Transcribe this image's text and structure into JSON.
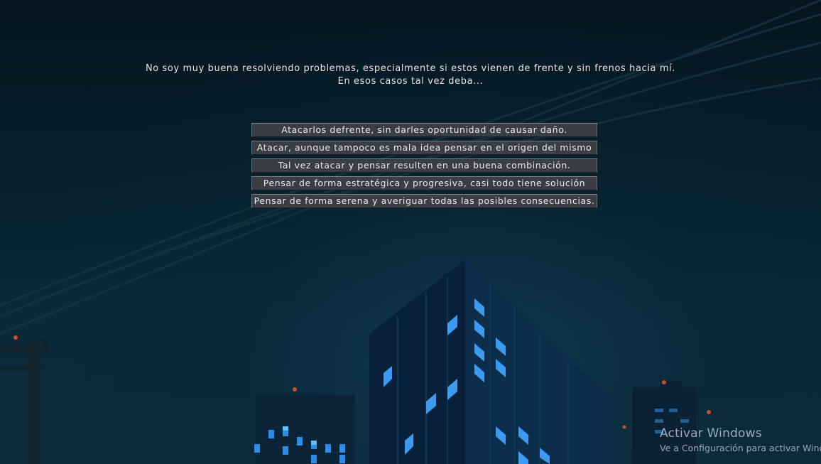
{
  "dialogue": {
    "line1": "No soy muy buena resolviendo problemas, especialmente si estos vienen de frente y sin frenos hacia mí.",
    "line2": "En esos casos tal vez deba..."
  },
  "choices": [
    "Atacarlos defrente, sin darles oportunidad de causar daño.",
    "Atacar, aunque tampoco es mala idea pensar en el origen del mismo",
    "Tal vez atacar y pensar resulten en una buena combinación.",
    "Pensar de forma estratégica y progresiva, casi todo tiene solución",
    "Pensar de forma serena y averiguar todas las posibles consecuencias."
  ],
  "watermark": {
    "title": "Activar Windows",
    "subtitle": "Ve a Configuración para activar Windows."
  },
  "colors": {
    "sky_dark": "#051521",
    "sky_mid": "#0a2a3a",
    "building": "#0c2a44",
    "window_lit": "#2f8fe0",
    "window_bright": "#58b8ff",
    "button_bg": "#3a3d43",
    "text": "#e8ecef"
  }
}
